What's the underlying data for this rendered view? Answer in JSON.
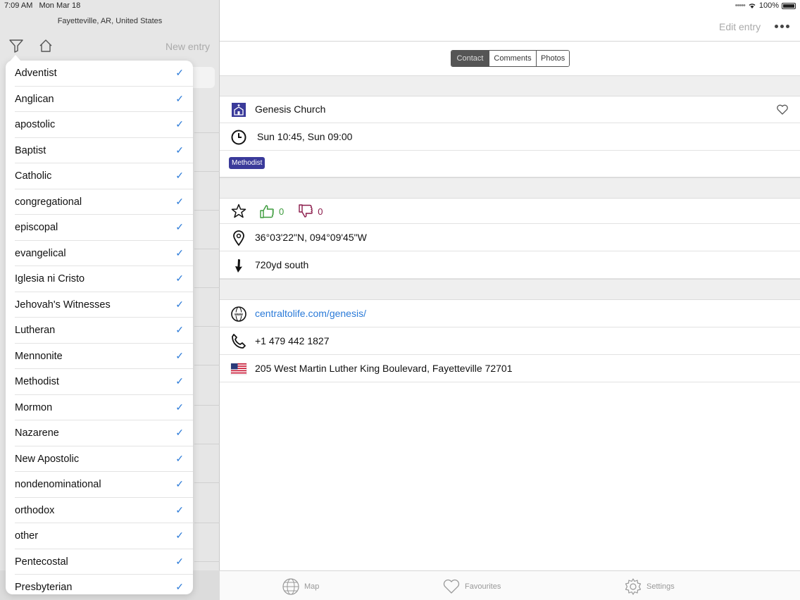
{
  "status_bar": {
    "time": "7:09 AM",
    "date": "Mon Mar 18",
    "battery": "100%"
  },
  "left": {
    "location": "Fayetteville, AR, United States",
    "new_entry": "New entry"
  },
  "filter_items": [
    "Adventist",
    "Anglican",
    "apostolic",
    "Baptist",
    "Catholic",
    "congregational",
    "episcopal",
    "evangelical",
    "Iglesia ni Cristo",
    "Jehovah's Witnesses",
    "Lutheran",
    "Mennonite",
    "Methodist",
    "Mormon",
    "Nazarene",
    "New Apostolic",
    "nondenominational",
    "orthodox",
    "other",
    "Pentecostal",
    "Presbyterian"
  ],
  "header": {
    "edit_entry": "Edit entry"
  },
  "tabs": {
    "contact": "Contact",
    "comments": "Comments",
    "photos": "Photos"
  },
  "detail": {
    "name": "Genesis Church",
    "hours": "Sun 10:45, Sun 09:00",
    "tag": "Methodist",
    "up_votes": "0",
    "down_votes": "0",
    "coordinates": "36°03'22\"N, 094°09'45\"W",
    "distance": "720yd south",
    "website": "centraltolife.com/genesis/",
    "phone": "+1 479 442 1827",
    "address": "205 West Martin Luther King Boulevard, Fayetteville 72701"
  },
  "tabbar": {
    "map": "Map",
    "favourites": "Favourites",
    "settings": "Settings"
  },
  "colors": {
    "link": "#2a7ad8",
    "tag": "#3a3a9a",
    "up": "#3a9a3a",
    "down": "#8a1a4a"
  }
}
